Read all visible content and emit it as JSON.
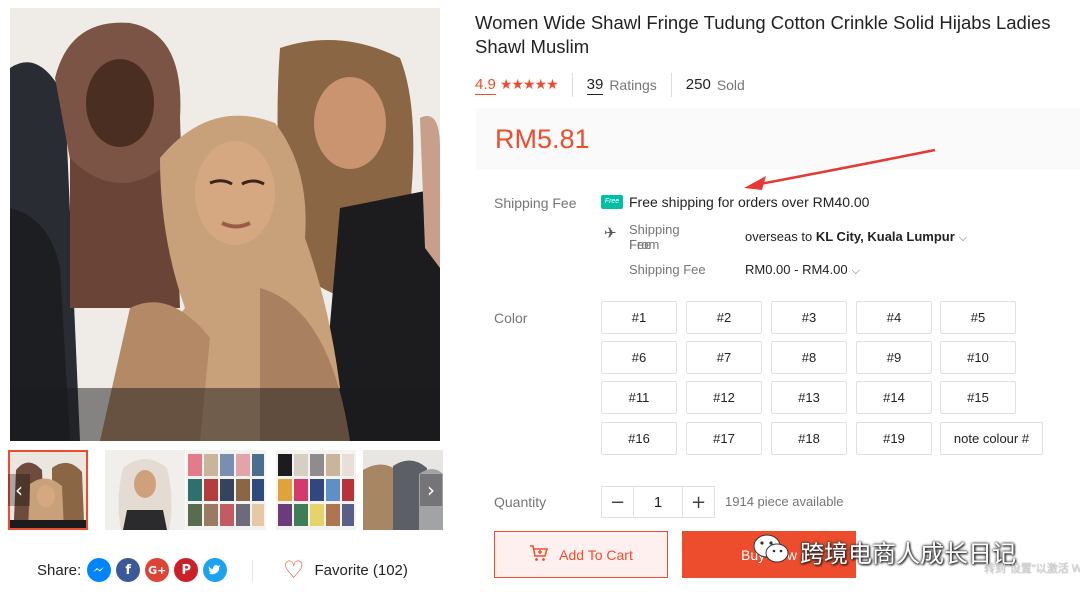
{
  "product": {
    "title": "Women Wide Shawl Fringe Tudung Cotton Crinkle Solid Hijabs Ladies Shawl Muslim",
    "rating": "4.9",
    "stars": "★★★★★",
    "ratings_count": "39",
    "ratings_label": "Ratings",
    "sold_count": "250",
    "sold_label": "Sold",
    "price": "RM5.81"
  },
  "shipping": {
    "label": "Shipping Fee",
    "free_badge": "Free",
    "free_text": "Free shipping for orders over RM40.00",
    "from_label_1": "Shipping Fee",
    "from_label_2": "From",
    "from_value": "overseas",
    "to_word": "to",
    "destination": "KL City, Kuala Lumpur",
    "fee_label": "Shipping Fee",
    "fee_value": "RM0.00 - RM4.00"
  },
  "color": {
    "label": "Color",
    "options": [
      "#1",
      "#2",
      "#3",
      "#4",
      "#5",
      "#6",
      "#7",
      "#8",
      "#9",
      "#10",
      "#11",
      "#12",
      "#13",
      "#14",
      "#15",
      "#16",
      "#17",
      "#18",
      "#19",
      "note colour #"
    ]
  },
  "quantity": {
    "label": "Quantity",
    "minus": "−",
    "value": "1",
    "plus": "+",
    "available": "1914 piece available"
  },
  "actions": {
    "add_to_cart": "Add To Cart",
    "buy_now": "Buy Now"
  },
  "share": {
    "label": "Share:",
    "networks": [
      "messenger-icon",
      "facebook-icon",
      "google-plus-icon",
      "pinterest-icon",
      "twitter-icon"
    ]
  },
  "favorite": {
    "label": "Favorite (102)"
  },
  "watermark": {
    "text": "跨境电商人成长日记",
    "sub": "转到\"设置\"以激活 Windows"
  },
  "colors": {
    "accent": "#ee4d2d",
    "free_ship": "#00bfa5"
  }
}
